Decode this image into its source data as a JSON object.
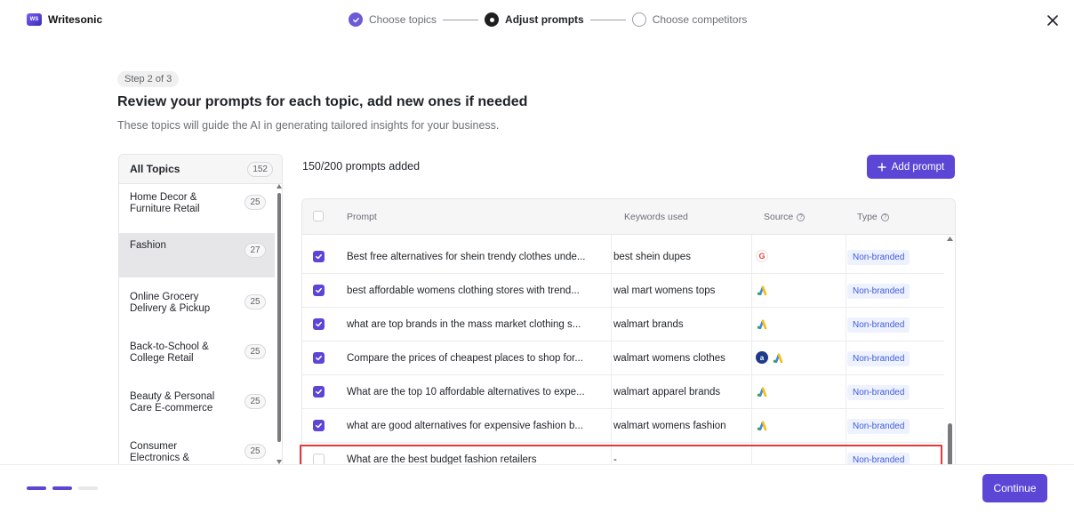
{
  "app": {
    "name": "Writesonic",
    "logo_mark": "WS"
  },
  "stepper": {
    "steps": [
      {
        "label": "Choose topics",
        "state": "done"
      },
      {
        "label": "Adjust prompts",
        "state": "current"
      },
      {
        "label": "Choose competitors",
        "state": "todo"
      }
    ]
  },
  "step_chip": "Step 2 of 3",
  "title": "Review your prompts for each topic, add new ones if needed",
  "subtitle": "These topics will guide the AI in generating tailored insights for your business.",
  "topics": {
    "header_label": "All Topics",
    "header_count": "152",
    "items": [
      {
        "name": "Home Decor & Furniture Retail",
        "count": "25"
      },
      {
        "name": "Fashion",
        "count": "27"
      },
      {
        "name": "Online Grocery Delivery & Pickup",
        "count": "25"
      },
      {
        "name": "Back-to-School & College Retail",
        "count": "25"
      },
      {
        "name": "Beauty & Personal Care E-commerce",
        "count": "25"
      },
      {
        "name": "Consumer Electronics &",
        "count": "25"
      }
    ]
  },
  "prompt_count": "150/200 prompts added",
  "add_prompt_label": "Add prompt",
  "table": {
    "columns": {
      "prompt": "Prompt",
      "keywords": "Keywords used",
      "source": "Source",
      "type": "Type"
    },
    "rows": [
      {
        "checked": true,
        "prompt": "Best free alternatives for shein trendy clothes unde...",
        "keywords": "best shein dupes",
        "sources": [
          "google-icon"
        ],
        "type": "Non-branded"
      },
      {
        "checked": true,
        "prompt": "best affordable womens clothing stores with trend...",
        "keywords": "wal mart womens tops",
        "sources": [
          "google-ads-icon"
        ],
        "type": "Non-branded"
      },
      {
        "checked": true,
        "prompt": "what are top brands in the mass market clothing s...",
        "keywords": "walmart brands",
        "sources": [
          "google-ads-icon"
        ],
        "type": "Non-branded"
      },
      {
        "checked": true,
        "prompt": "Compare the prices of cheapest places to shop for...",
        "keywords": "walmart womens clothes",
        "sources": [
          "openai-icon",
          "google-ads-icon"
        ],
        "type": "Non-branded"
      },
      {
        "checked": true,
        "prompt": "What are the top 10 affordable alternatives to expe...",
        "keywords": "walmart apparel brands",
        "sources": [
          "google-ads-icon"
        ],
        "type": "Non-branded"
      },
      {
        "checked": true,
        "prompt": "what are good alternatives for expensive fashion b...",
        "keywords": "walmart womens fashion",
        "sources": [
          "google-ads-icon"
        ],
        "type": "Non-branded"
      },
      {
        "checked": false,
        "prompt": "What are the best budget fashion retailers",
        "keywords": "-",
        "sources": [],
        "type": "Non-branded"
      }
    ]
  },
  "continue_label": "Continue",
  "colors": {
    "accent": "#5b46d6",
    "highlight": "#e23a3a",
    "badge_text": "#3f5bd8",
    "badge_bg": "#eef2ff"
  }
}
